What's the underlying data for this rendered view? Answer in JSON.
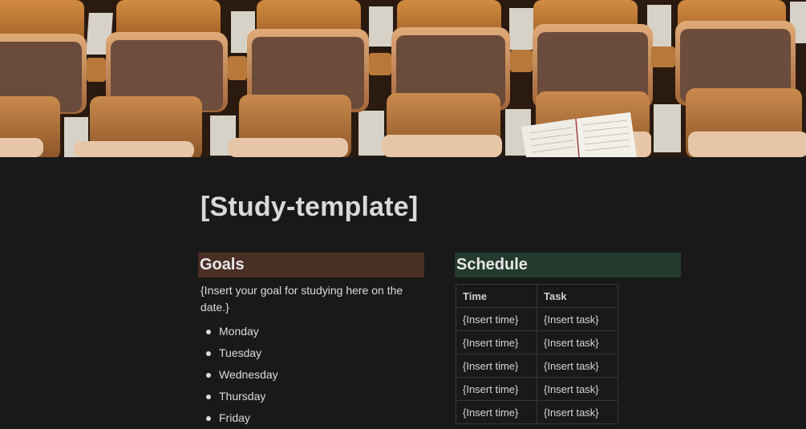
{
  "page": {
    "title": "[Study-template]"
  },
  "goals": {
    "heading": "Goals",
    "text": "{Insert your goal for studying here on the date.}",
    "days": [
      "Monday",
      "Tuesday",
      "Wednesday",
      "Thursday",
      "Friday"
    ]
  },
  "schedule": {
    "heading": "Schedule",
    "columns": [
      "Time",
      "Task"
    ],
    "rows": [
      [
        "{Insert time}",
        "{Insert task}"
      ],
      [
        "{Insert time}",
        "{Insert task}"
      ],
      [
        "{Insert time}",
        "{Insert task}"
      ],
      [
        "{Insert time}",
        "{Insert task}"
      ],
      [
        "{Insert time}",
        "{Insert task}"
      ]
    ]
  },
  "colors": {
    "background": "#191919",
    "goals_heading_bg": "#4a2f25",
    "schedule_heading_bg": "#243a2e",
    "seat_orange": "#c07a32"
  }
}
